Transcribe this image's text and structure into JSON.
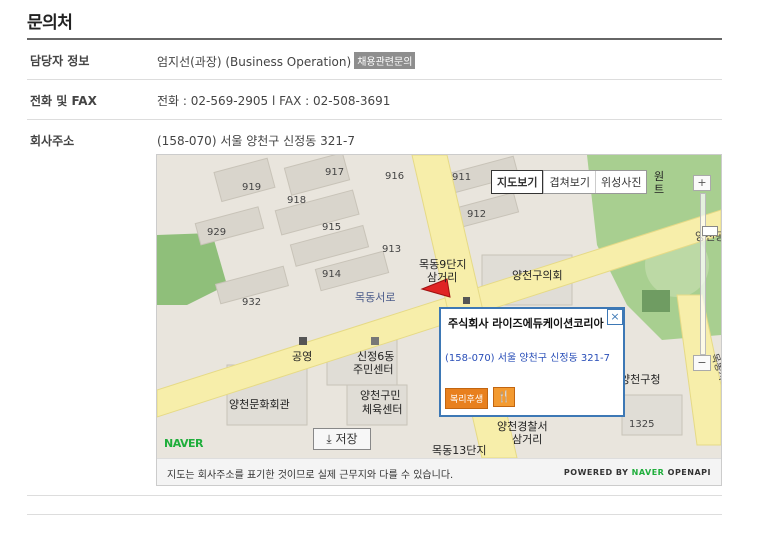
{
  "section_title": "문의처",
  "rows": {
    "contact": {
      "label": "담당자 정보",
      "value": "엄지선(과장) (Business Operation)",
      "badge": "채용관련문의"
    },
    "phone": {
      "label": "전화 및 FAX",
      "value": "전화 : 02-569-2905 l FAX : 02-508-3691"
    },
    "address": {
      "label": "회사주소",
      "value": "(158-070) 서울 양천구 신정동 321-7"
    }
  },
  "map": {
    "map_types": [
      "지도보기",
      "겹쳐보기",
      "위성사진"
    ],
    "active_map_type": "지도보기",
    "zoom_in": "+",
    "zoom_out": "−",
    "info_window": {
      "company": "주식회사 라이즈에듀케이션코리아",
      "address": "(158-070) 서울 양천구 신정동 321-7",
      "tag": "복리후생",
      "close": "×"
    },
    "save_button": "저장",
    "logo": "NAVER",
    "footer_note": "지도는 회사주소를 표기한 것이므로 실제 근무지와 다를 수 있습니다.",
    "powered_by": "POWERED BY",
    "powered_brand": "NAVER",
    "powered_api": "OPENAPI",
    "labels": {
      "road": "목동서로",
      "apt_area_1": "목동9단지",
      "apt_area_1b": "삼거리",
      "district_office": "양천구의회",
      "police": "공영",
      "center_1": "신정6동",
      "center_1b": "주민센터",
      "hall": "양천문화회관",
      "gym_1": "양천구민",
      "gym_1b": "체육센터",
      "ward_office_1": "양천구청",
      "station": "양천경찰서",
      "station_b": "삼거리",
      "junction_1": "목동13단지",
      "corner_right": "양천공",
      "right_road": "목동서로",
      "top_right": "원",
      "top_right2": "트",
      "b917": "917",
      "b916": "916",
      "b919": "919",
      "b918": "918",
      "b929": "929",
      "b915": "915",
      "b913": "913",
      "b914": "914",
      "b932": "932",
      "b911": "911",
      "b912": "912",
      "b1325": "1325"
    }
  },
  "colors": {
    "accent_blue": "#3d78b5",
    "tag_orange": "#e8801e",
    "naver_green": "#1fae3b",
    "road_yellow": "#f7eeaa",
    "park_green": "#8fbf7a"
  }
}
